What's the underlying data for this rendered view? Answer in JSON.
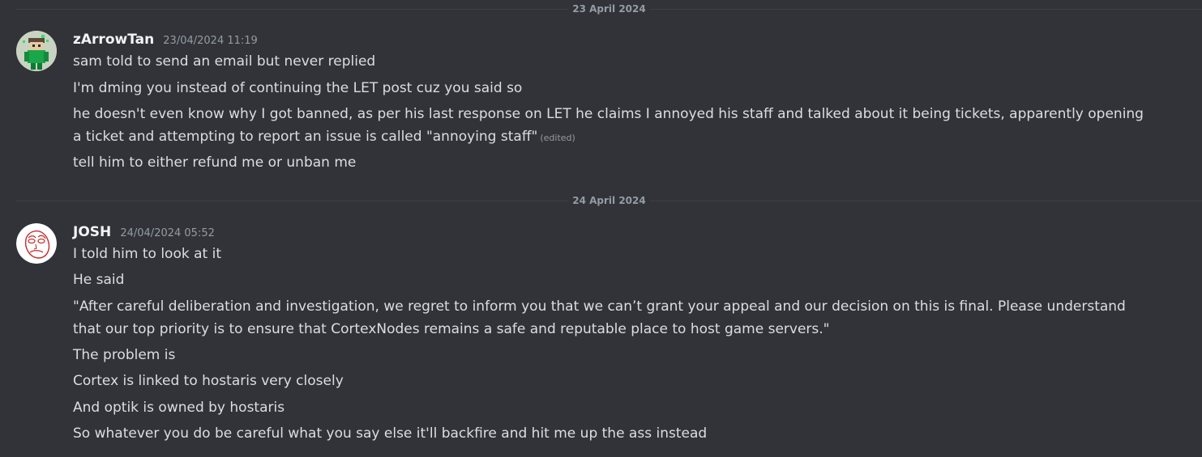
{
  "dividers": {
    "first": "23 April 2024",
    "second": "24 April 2024"
  },
  "messages": [
    {
      "username": "zArrowTan",
      "timestamp": "23/04/2024 11:19",
      "avatar": "pixel-character-avatar",
      "lines": [
        "sam told to send an email but never replied",
        "I'm dming you instead of continuing the LET post cuz you said so",
        "he doesn't even know why I got banned, as per his last response on LET he claims I annoyed his staff and talked about it being tickets, apparently opening a ticket and attempting to report an issue is called \"annoying staff\"",
        "tell him to either refund me or unban me"
      ],
      "edited_label": "(edited)"
    },
    {
      "username": "JOSH",
      "timestamp": "24/04/2024 05:52",
      "avatar": "sketch-face-avatar",
      "lines": [
        "I told him to look at it",
        "He said",
        "\"After careful deliberation and investigation, we regret to inform you that we can’t grant your appeal and our decision on this is final. Please understand that our top priority is to ensure that CortexNodes remains a safe and reputable place to host game servers.\"",
        "The problem is",
        "Cortex is linked to hostaris very closely",
        "And optik is owned by hostaris",
        "So whatever you do be careful what you say else it'll backfire and hit me up the ass instead"
      ]
    }
  ],
  "colors": {
    "background": "#313338",
    "text": "#dbdee1",
    "username": "#f2f3f5",
    "muted": "#949ba4",
    "divider": "#3f4147"
  }
}
